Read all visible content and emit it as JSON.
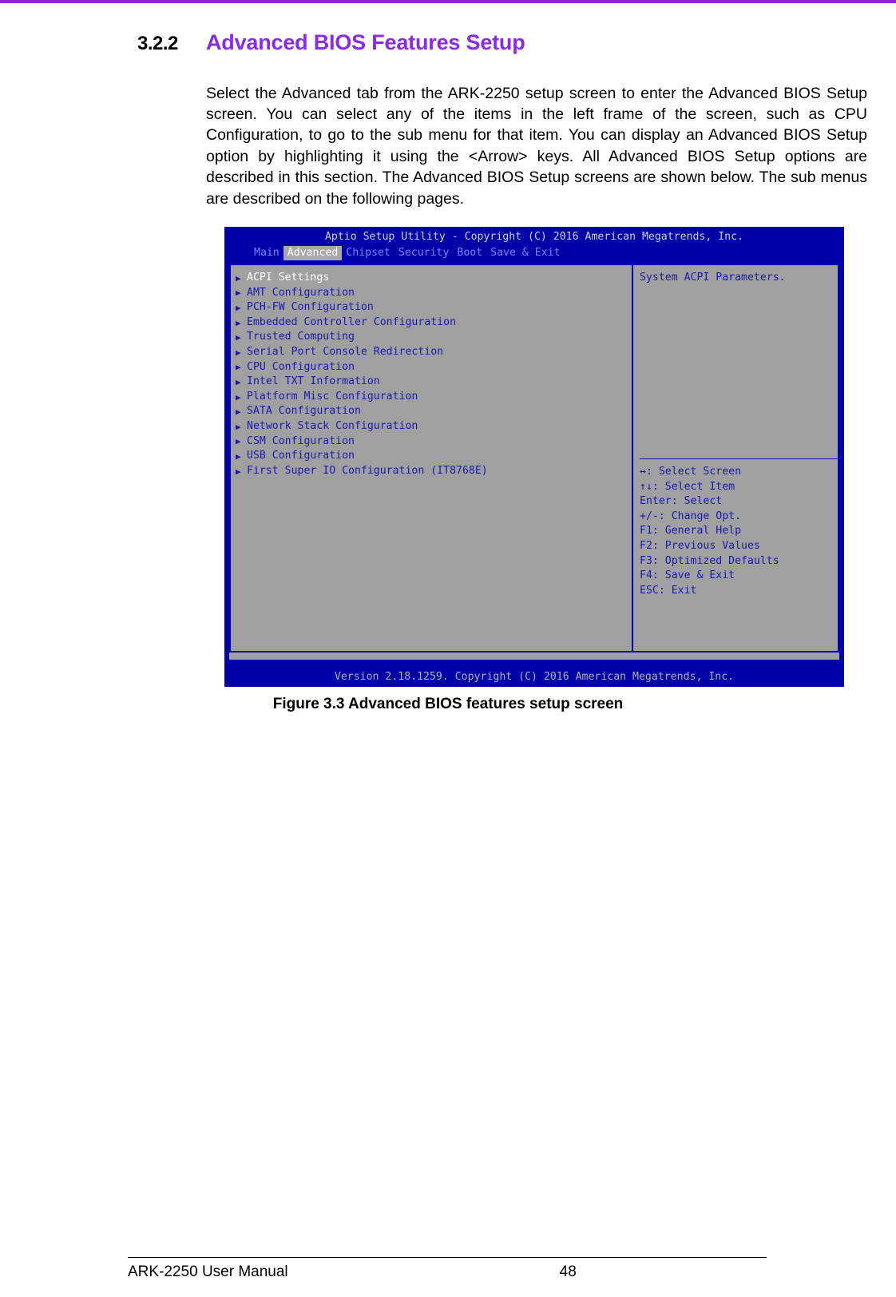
{
  "section": {
    "number": "3.2.2",
    "title": "Advanced BIOS Features Setup",
    "paragraph": "Select the Advanced tab from the ARK-2250 setup screen to enter the Advanced BIOS Setup screen. You can select any of the items in the left frame of the screen, such as CPU Configuration, to go to the sub menu for that item. You can display an Advanced BIOS Setup option by highlighting it using the <Arrow> keys. All Advanced BIOS Setup options are described in this section. The Advanced BIOS Setup screens are shown below. The sub menus are described on the following pages."
  },
  "bios": {
    "title": "Aptio Setup Utility - Copyright (C) 2016 American Megatrends, Inc.",
    "tabs": [
      {
        "label": "Main",
        "active": false
      },
      {
        "label": "Advanced",
        "active": true
      },
      {
        "label": "Chipset",
        "active": false
      },
      {
        "label": "Security",
        "active": false
      },
      {
        "label": "Boot",
        "active": false
      },
      {
        "label": "Save & Exit",
        "active": false
      }
    ],
    "menu_items": [
      {
        "label": "ACPI Settings",
        "selected": true
      },
      {
        "label": "AMT Configuration",
        "selected": false
      },
      {
        "label": "PCH-FW Configuration",
        "selected": false
      },
      {
        "label": "Embedded Controller Configuration",
        "selected": false
      },
      {
        "label": "Trusted Computing",
        "selected": false
      },
      {
        "label": "Serial Port Console Redirection",
        "selected": false
      },
      {
        "label": "CPU Configuration",
        "selected": false
      },
      {
        "label": "Intel TXT Information",
        "selected": false
      },
      {
        "label": "Platform Misc Configuration",
        "selected": false
      },
      {
        "label": "SATA Configuration",
        "selected": false
      },
      {
        "label": "Network Stack Configuration",
        "selected": false
      },
      {
        "label": "CSM Configuration",
        "selected": false
      },
      {
        "label": "USB Configuration",
        "selected": false
      },
      {
        "label": "First Super IO Configuration (IT8768E)",
        "selected": false
      }
    ],
    "help_text": "System ACPI Parameters.",
    "legend": [
      "↔: Select Screen",
      "↑↓: Select Item",
      "Enter: Select",
      "+/-: Change Opt.",
      "F1: General Help",
      "F2: Previous Values",
      "F3: Optimized Defaults",
      "F4: Save & Exit",
      "ESC: Exit"
    ],
    "footer": "Version 2.18.1259. Copyright (C) 2016 American Megatrends, Inc."
  },
  "figure": {
    "caption": "Figure 3.3 Advanced BIOS features setup screen"
  },
  "page_footer": {
    "manual": "ARK-2250 User Manual",
    "page_number": "48"
  },
  "colors": {
    "accent": "#8a2be2",
    "bios_blue": "#0000a8",
    "bios_gray": "#a0a0a0",
    "bios_text_blue": "#1a1ab0"
  }
}
